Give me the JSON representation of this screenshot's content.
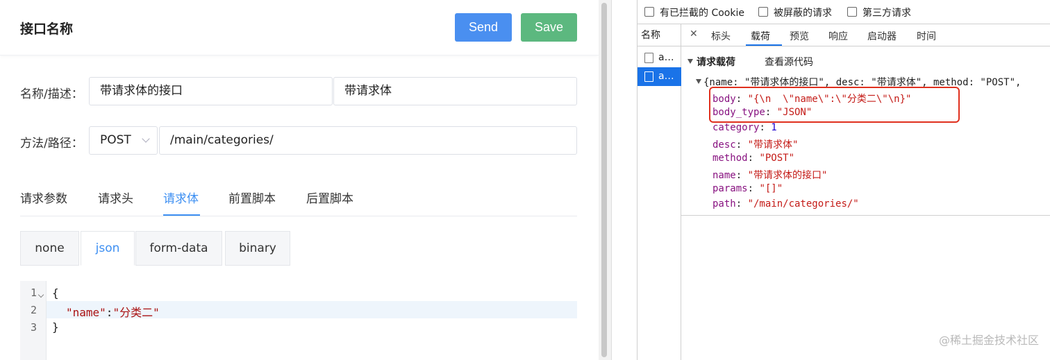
{
  "header": {
    "title": "接口名称",
    "send_label": "Send",
    "save_label": "Save"
  },
  "form": {
    "name_desc_label": "名称/描述：",
    "name_value": "带请求体的接口",
    "desc_value": "带请求体",
    "method_path_label": "方法/路径：",
    "method_value": "POST",
    "path_value": "/main/categories/"
  },
  "tabs": [
    "请求参数",
    "请求头",
    "请求体",
    "前置脚本",
    "后置脚本"
  ],
  "active_tab": "请求体",
  "body_types": [
    "none",
    "json",
    "form-data",
    "binary"
  ],
  "active_body_type": "json",
  "editor": {
    "line_numbers": [
      "1",
      "2",
      "3"
    ],
    "lines": {
      "l1": "{",
      "l2_key": "\"name\"",
      "l2_colon": ":",
      "l2_val": "\"分类二\"",
      "l3": "}"
    }
  },
  "devtools": {
    "filters": [
      "有已拦截的 Cookie",
      "被屏蔽的请求",
      "第三方请求"
    ],
    "name_column_header": "名称",
    "requests": [
      "a…",
      "a…"
    ],
    "tabs": [
      "标头",
      "载荷",
      "预览",
      "响应",
      "启动器",
      "时间"
    ],
    "active_tab": "载荷",
    "payload": {
      "section_title": "请求载荷",
      "view_source": "查看源代码",
      "summary": "{name: \"带请求体的接口\", desc: \"带请求体\", method: \"POST\",",
      "fields": [
        {
          "key": "body",
          "value": "\"{\\n  \\\"name\\\":\\\"分类二\\\"\\n}\"",
          "kind": "string"
        },
        {
          "key": "body_type",
          "value": "\"JSON\"",
          "kind": "string"
        },
        {
          "key": "category",
          "value": "1",
          "kind": "number"
        },
        {
          "key": "desc",
          "value": "\"带请求体\"",
          "kind": "string"
        },
        {
          "key": "method",
          "value": "\"POST\"",
          "kind": "string"
        },
        {
          "key": "name",
          "value": "\"带请求体的接口\"",
          "kind": "string"
        },
        {
          "key": "params",
          "value": "\"[]\"",
          "kind": "string"
        },
        {
          "key": "path",
          "value": "\"/main/categories/\"",
          "kind": "string"
        }
      ]
    }
  },
  "watermark": "@稀土掘金技术社区",
  "colors": {
    "primary": "#4a8ff0",
    "success": "#5cb87f",
    "devtools_accent": "#1a73e8",
    "highlight": "#e0301e"
  }
}
